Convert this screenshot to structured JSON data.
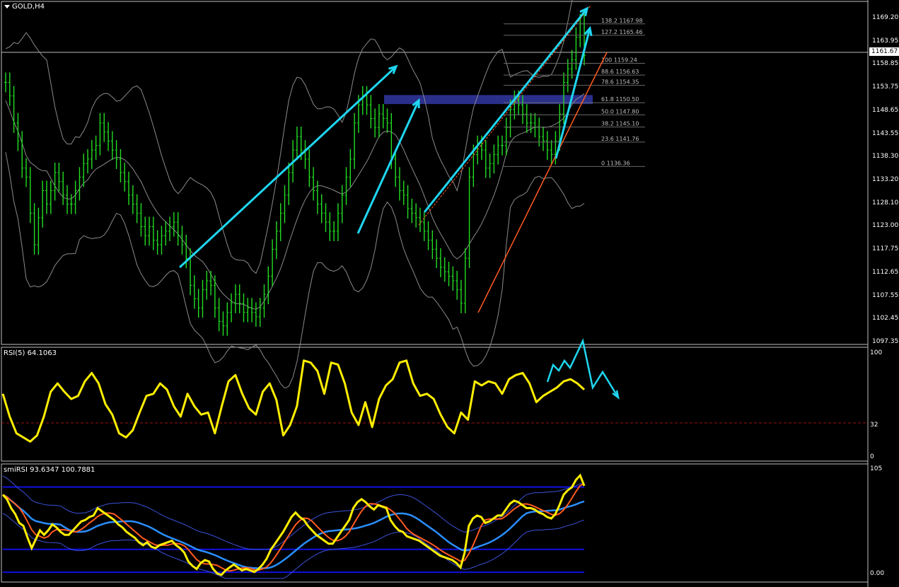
{
  "chart_title": "GOLD,H4",
  "current_price": "1161.67",
  "price_axis": [
    "1169.20",
    "1163.95",
    "1158.85",
    "1153.75",
    "1148.65",
    "1143.55",
    "1138.30",
    "1133.20",
    "1128.10",
    "1123.00",
    "1117.75",
    "1112.65",
    "1107.55",
    "1102.45",
    "1097.35"
  ],
  "rsi": {
    "title": "RSI(5) 64.1063",
    "axis": [
      "100",
      "32",
      "0"
    ]
  },
  "smi": {
    "title": "smiRSI 93.6347 100.7881",
    "axis_top": "105",
    "axis_bottom": "0.00"
  },
  "colors": {
    "bars": "#22dd22",
    "bands": "#8a8a8a",
    "arrows": "#1fd6f0",
    "trend": "#ff5a1f",
    "rsi": "#ffee00",
    "zone": "#2a2f8a",
    "blue": "#1010e0",
    "midblue": "#2a8fff"
  },
  "chart_data": [
    {
      "type": "line",
      "name": "GOLD H4 price",
      "ylim": [
        1097.35,
        1172
      ],
      "close": [
        1155,
        1152,
        1146,
        1142,
        1136,
        1134,
        1126,
        1119,
        1125,
        1131,
        1128,
        1131,
        1135,
        1133,
        1130,
        1128,
        1128,
        1131,
        1134,
        1137,
        1138,
        1140,
        1141,
        1146,
        1144,
        1142,
        1140,
        1138,
        1135,
        1133,
        1130,
        1128,
        1126,
        1123,
        1121,
        1123,
        1120,
        1119,
        1121,
        1122,
        1123,
        1124,
        1121,
        1119,
        1116,
        1110,
        1107,
        1105,
        1109,
        1111,
        1110,
        1105,
        1102,
        1101,
        1104,
        1106,
        1108,
        1106,
        1104,
        1105,
        1104,
        1103,
        1105,
        1108,
        1112,
        1118,
        1122,
        1126,
        1130,
        1135,
        1140,
        1143,
        1140,
        1138,
        1134,
        1131,
        1128,
        1126,
        1124,
        1122,
        1122,
        1126,
        1130,
        1134,
        1138,
        1146,
        1150,
        1152,
        1150,
        1147,
        1145,
        1148,
        1147,
        1146,
        1138,
        1134,
        1131,
        1130,
        1127,
        1126,
        1125,
        1124,
        1122,
        1120,
        1118,
        1116,
        1114,
        1113,
        1112,
        1111,
        1109,
        1106,
        1116,
        1134,
        1139,
        1141,
        1140,
        1136,
        1137,
        1139,
        1141,
        1141,
        1145,
        1149,
        1151,
        1150,
        1148,
        1146,
        1146,
        1145,
        1143,
        1142,
        1140,
        1139,
        1142,
        1148,
        1155,
        1158,
        1160,
        1165,
        1168,
        1161
      ],
      "series": [
        {
          "name": "",
          "points": [
            [
              -1,
              1
            ]
          ]
        }
      ],
      "fibonacci": [
        {
          "level": "138.2",
          "price": "1167.98",
          "value": 1167.98
        },
        {
          "level": "127.2",
          "price": "1165.46",
          "value": 1165.46
        },
        {
          "level": "100",
          "price": "1159.24",
          "value": 1159.24
        },
        {
          "level": "88.6",
          "price": "1156.63",
          "value": 1156.63
        },
        {
          "level": "78.6",
          "price": "1154.35",
          "value": 1154.35
        },
        {
          "level": "61.8",
          "price": "1150.50",
          "value": 1150.5
        },
        {
          "level": "50.0",
          "price": "1147.80",
          "value": 1147.8
        },
        {
          "level": "38.2",
          "price": "1145.10",
          "value": 1145.1
        },
        {
          "level": "23.6",
          "price": "1141.76",
          "value": 1141.76
        },
        {
          "level": "0",
          "price": "1136.36",
          "value": 1136.36
        }
      ],
      "resistance_zone": [
        1150.2,
        1152.2
      ]
    },
    {
      "type": "line",
      "name": "RSI(5)",
      "ylim": [
        0,
        100
      ],
      "level": 32,
      "values": [
        60,
        38,
        22,
        18,
        14,
        20,
        38,
        62,
        70,
        62,
        55,
        58,
        72,
        80,
        70,
        50,
        40,
        22,
        18,
        25,
        42,
        58,
        60,
        70,
        64,
        48,
        38,
        60,
        48,
        40,
        42,
        22,
        48,
        72,
        78,
        60,
        46,
        40,
        62,
        70,
        54,
        20,
        30,
        48,
        92,
        90,
        82,
        60,
        90,
        88,
        70,
        42,
        30,
        52,
        28,
        55,
        68,
        74,
        90,
        92,
        70,
        58,
        60,
        55,
        40,
        28,
        22,
        42,
        35,
        72,
        68,
        72,
        70,
        60,
        74,
        78,
        80,
        70,
        52,
        58,
        62,
        66,
        72,
        74,
        70,
        64
      ]
    }
  ]
}
